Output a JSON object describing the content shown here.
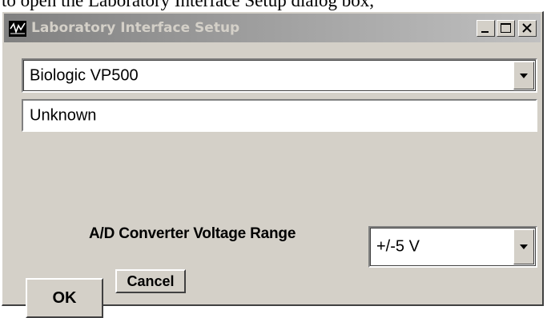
{
  "caption": "to open the Laboratory Interface Setup dialog box,",
  "window": {
    "title": "Laboratory Interface Setup",
    "icon": "app-icon",
    "controls": {
      "minimize_icon": "minimize-icon",
      "maximize_icon": "maximize-icon",
      "close_icon": "close-icon"
    }
  },
  "form": {
    "device_select": {
      "value": "Biologic VP500"
    },
    "status_field": {
      "value": "Unknown"
    },
    "range_label": "A/D  Converter Voltage Range",
    "range_select": {
      "value": "+/-5 V"
    }
  },
  "buttons": {
    "ok_label": "OK",
    "cancel_label": "Cancel"
  },
  "colors": {
    "dialog_face": "#d4d0c8",
    "titlebar_gradient_start": "#808080",
    "titlebar_gradient_end": "#c0c0c0",
    "title_text": "#d4d0c8"
  }
}
